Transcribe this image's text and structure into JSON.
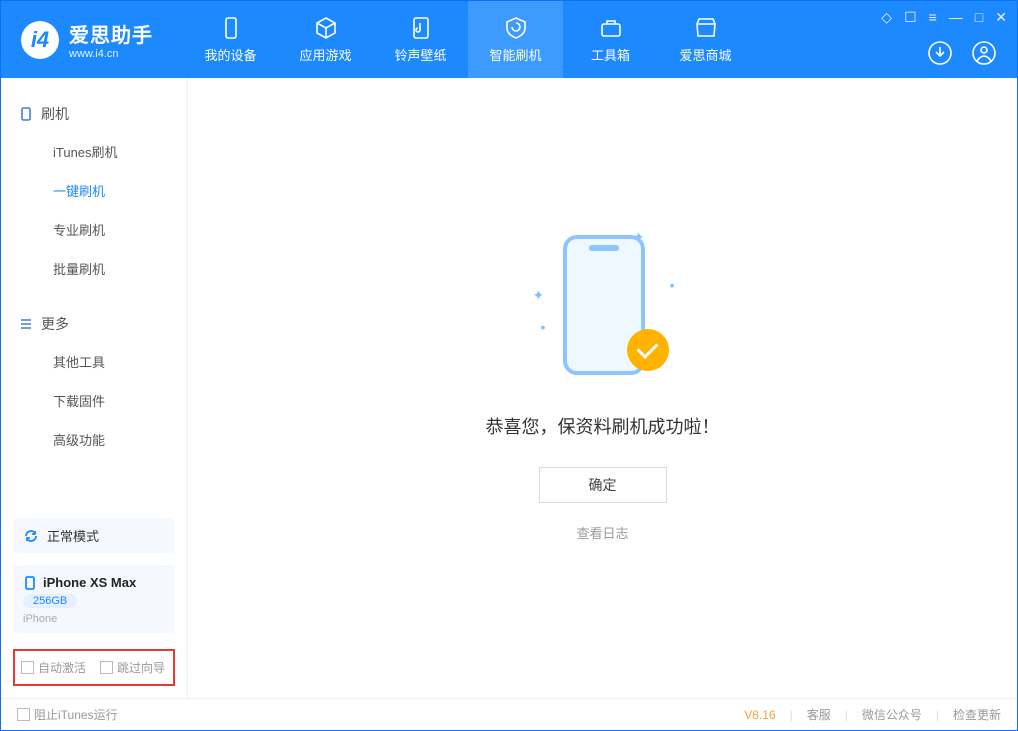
{
  "app": {
    "name": "爱思助手",
    "url": "www.i4.cn"
  },
  "header_tabs": [
    {
      "label": "我的设备"
    },
    {
      "label": "应用游戏"
    },
    {
      "label": "铃声壁纸"
    },
    {
      "label": "智能刷机",
      "active": true
    },
    {
      "label": "工具箱"
    },
    {
      "label": "爱思商城"
    }
  ],
  "sidebar": {
    "section1": {
      "title": "刷机",
      "items": [
        {
          "label": "iTunes刷机"
        },
        {
          "label": "一键刷机",
          "active": true
        },
        {
          "label": "专业刷机"
        },
        {
          "label": "批量刷机"
        }
      ]
    },
    "section2": {
      "title": "更多",
      "items": [
        {
          "label": "其他工具"
        },
        {
          "label": "下载固件"
        },
        {
          "label": "高级功能"
        }
      ]
    },
    "mode_box": "正常模式",
    "device": {
      "name": "iPhone XS Max",
      "storage": "256GB",
      "type": "iPhone"
    },
    "bottom_checks": {
      "auto_activate": "自动激活",
      "skip_guide": "跳过向导"
    }
  },
  "main": {
    "message": "恭喜您，保资料刷机成功啦！",
    "ok_button": "确定",
    "log_link": "查看日志"
  },
  "footer": {
    "block_itunes": "阻止iTunes运行",
    "version": "V8.16",
    "links": {
      "service": "客服",
      "wechat": "微信公众号",
      "update": "检查更新"
    }
  }
}
